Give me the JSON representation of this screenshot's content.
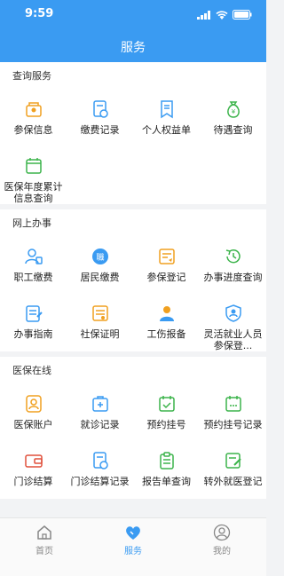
{
  "status": {
    "time": "9:59"
  },
  "header": {
    "title": "服务"
  },
  "sections": [
    {
      "title": "查询服务",
      "items": [
        "参保信息",
        "缴费记录",
        "个人权益单",
        "待遇查询",
        "医保年度累计信息查询"
      ]
    },
    {
      "title": "网上办事",
      "items": [
        "职工缴费",
        "居民缴费",
        "参保登记",
        "办事进度查询",
        "办事指南",
        "社保证明",
        "工伤报备",
        "灵活就业人员参保登..."
      ]
    },
    {
      "title": "医保在线",
      "items": [
        "医保账户",
        "就诊记录",
        "预约挂号",
        "预约挂号记录",
        "门诊结算",
        "门诊结算记录",
        "报告单查询",
        "转外就医登记"
      ]
    }
  ],
  "tabs": [
    {
      "label": "首页",
      "icon": "home-icon"
    },
    {
      "label": "服务",
      "icon": "heart-icon"
    },
    {
      "label": "我的",
      "icon": "user-icon"
    }
  ],
  "colors": {
    "primary": "#3a9bf2",
    "orange": "#f0a020",
    "green": "#3cb44b"
  }
}
